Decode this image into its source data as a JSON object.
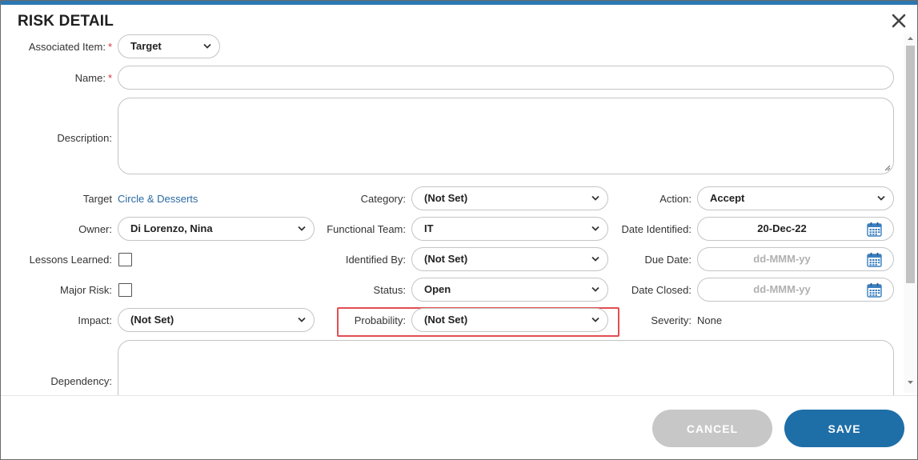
{
  "dialog": {
    "title": "RISK DETAIL"
  },
  "form": {
    "associated_item": {
      "label": "Associated Item:",
      "value": "Target",
      "required": "*"
    },
    "name": {
      "label": "Name:",
      "value": "",
      "required": "*"
    },
    "description": {
      "label": "Description:",
      "value": ""
    },
    "target": {
      "label": "Target",
      "link": "Circle & Desserts"
    },
    "category": {
      "label": "Category:",
      "value": "(Not Set)"
    },
    "action": {
      "label": "Action:",
      "value": "Accept"
    },
    "owner": {
      "label": "Owner:",
      "value": "Di Lorenzo, Nina"
    },
    "functional_team": {
      "label": "Functional Team:",
      "value": "IT"
    },
    "date_identified": {
      "label": "Date Identified:",
      "value": "20-Dec-22"
    },
    "lessons_learned": {
      "label": "Lessons Learned:",
      "checked": false
    },
    "identified_by": {
      "label": "Identified By:",
      "value": "(Not Set)"
    },
    "due_date": {
      "label": "Due Date:",
      "placeholder": "dd-MMM-yy"
    },
    "major_risk": {
      "label": "Major Risk:",
      "checked": false
    },
    "status": {
      "label": "Status:",
      "value": "Open"
    },
    "date_closed": {
      "label": "Date Closed:",
      "placeholder": "dd-MMM-yy"
    },
    "impact": {
      "label": "Impact:",
      "value": "(Not Set)"
    },
    "probability": {
      "label": "Probability:",
      "value": "(Not Set)"
    },
    "severity": {
      "label": "Severity:",
      "value": "None"
    },
    "dependency": {
      "label": "Dependency:",
      "value": ""
    }
  },
  "footer": {
    "cancel_label": "CANCEL",
    "save_label": "SAVE"
  },
  "colors": {
    "accent": "#1e6ea8",
    "required": "#d9323a",
    "highlight": "#e14d52",
    "link": "#2a6aa3",
    "cancel_disabled": "#c7c7c7"
  },
  "icons": [
    "close-icon",
    "chevron-down-icon",
    "calendar-icon"
  ]
}
